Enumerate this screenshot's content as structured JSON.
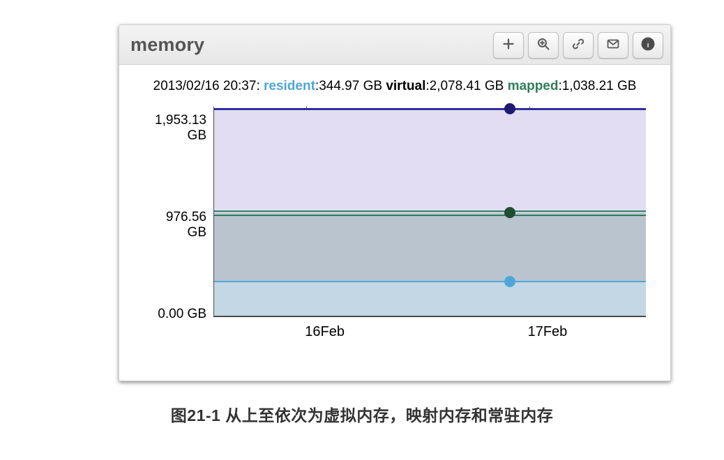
{
  "panel": {
    "title": "memory",
    "toolbar_icons": [
      "plus",
      "zoom",
      "link",
      "mail",
      "info"
    ]
  },
  "legend": {
    "timestamp": "2013/02/16 20:37",
    "items": [
      {
        "key": "resident",
        "value": "344.97 GB"
      },
      {
        "key": "virtual",
        "value": "2,078.41 GB"
      },
      {
        "key": "mapped",
        "value": "1,038.21 GB"
      }
    ]
  },
  "y_ticks": [
    {
      "label": "1,953.13\nGB",
      "value": 1953.13
    },
    {
      "label": "976.56\nGB",
      "value": 976.56
    },
    {
      "label": "0.00 GB",
      "value": 0.0
    }
  ],
  "x_ticks": [
    {
      "label": "16Feb",
      "pos": 0.215
    },
    {
      "label": "17Feb",
      "pos": 0.73
    }
  ],
  "hover_x_pos": 0.685,
  "colors": {
    "virtual_fill": "#e2ddf3",
    "virtual_line": "#302e9c",
    "mapped_fill": "#b9c4cf",
    "mapped_line": "#2f7f5b",
    "resident_fill": "#c3d7e5",
    "resident_line": "#4da6d9"
  },
  "caption": "图21-1 从上至依次为虚拟内存，映射内存和常驻内存",
  "chart_data": {
    "type": "area",
    "title": "memory",
    "xlabel": "",
    "ylabel": "GB",
    "ylim": [
      0,
      2100
    ],
    "x": [
      "16Feb",
      "17Feb"
    ],
    "hover": {
      "timestamp": "2013/02/16 20:37",
      "resident": 344.97,
      "virtual": 2078.41,
      "mapped": 1038.21
    },
    "series": [
      {
        "name": "virtual",
        "unit": "GB",
        "values": [
          2078.41,
          2078.41
        ]
      },
      {
        "name": "mapped",
        "unit": "GB",
        "values": [
          1038.21,
          1038.21
        ]
      },
      {
        "name": "resident",
        "unit": "GB",
        "values": [
          344.97,
          344.97
        ]
      }
    ]
  }
}
